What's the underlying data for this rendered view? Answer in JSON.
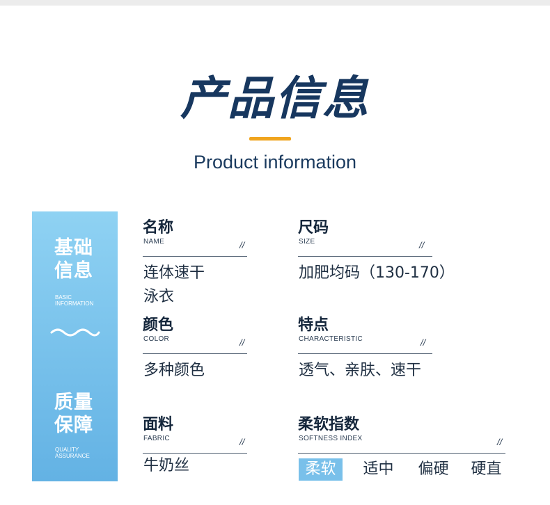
{
  "header": {
    "title": "产品信息",
    "subtitle": "Product information"
  },
  "sidebar": {
    "basic_cn_1": "基础",
    "basic_cn_2": "信息",
    "basic_en_1": "BASIC",
    "basic_en_2": "INFORMATION",
    "quality_cn_1": "质量",
    "quality_cn_2": "保障",
    "quality_en_1": "QUALITY",
    "quality_en_2": "ASSURANCE"
  },
  "fields": {
    "name": {
      "cn": "名称",
      "en": "NAME",
      "mark": "//",
      "value_1": "连体速干",
      "value_2": "泳衣"
    },
    "size": {
      "cn": "尺码",
      "en": "SIZE",
      "mark": "//",
      "value": "加肥均码（130-170）"
    },
    "color": {
      "cn": "颜色",
      "en": "COLOR",
      "mark": "//",
      "value": "多种颜色"
    },
    "feature": {
      "cn": "特点",
      "en": "CHARACTERISTIC",
      "mark": "//",
      "value": "透气、亲肤、速干"
    },
    "fabric": {
      "cn": "面料",
      "en": "FABRIC",
      "mark": "//",
      "value": "牛奶丝"
    },
    "softness": {
      "cn": "柔软指数",
      "en": "SOFTNESS INDEX",
      "mark": "//",
      "options": [
        "柔软",
        "适中",
        "偏硬",
        "硬直"
      ],
      "selected": "柔软"
    }
  },
  "colors": {
    "title": "#17375f",
    "accent": "#f0a41d",
    "sidebar_top": "#8fd2f3",
    "sidebar_bottom": "#63b2e4",
    "highlight": "#79c0ea"
  }
}
